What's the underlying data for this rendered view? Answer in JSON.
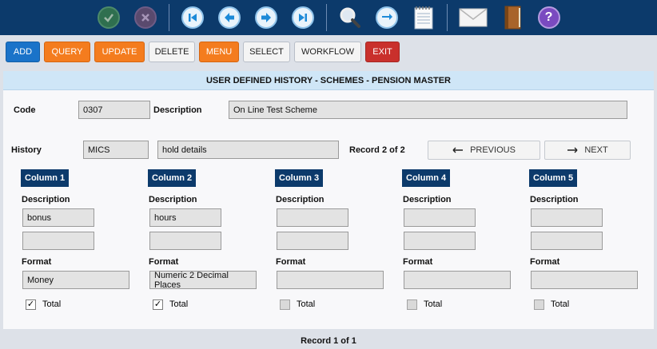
{
  "toolbar": {
    "icons": [
      "check-icon",
      "cancel-icon",
      "first-record-icon",
      "previous-record-icon",
      "next-record-icon",
      "last-record-icon",
      "search-icon",
      "refresh-icon",
      "notepad-icon",
      "mail-icon",
      "book-icon",
      "help-icon"
    ],
    "help_glyph": "?"
  },
  "actions": {
    "add": "ADD",
    "query": "QUERY",
    "update": "UPDATE",
    "delete": "DELETE",
    "menu": "MENU",
    "select": "SELECT",
    "workflow": "WORKFLOW",
    "exit": "EXIT"
  },
  "panel": {
    "title": "USER DEFINED HISTORY - SCHEMES - PENSION MASTER",
    "code_label": "Code",
    "code_value": "0307",
    "description_label": "Description",
    "description_value": "On Line Test Scheme",
    "history_label": "History",
    "history_code": "MICS",
    "history_desc": "hold details",
    "record_label": "Record 2 of 2",
    "previous": "PREVIOUS",
    "next": "NEXT"
  },
  "columns": [
    {
      "title": "Column 1",
      "desc_label": "Description",
      "desc1": "bonus",
      "desc2": "",
      "format_label": "Format",
      "format": "Money",
      "total_label": "Total",
      "total_checked": true
    },
    {
      "title": "Column 2",
      "desc_label": "Description",
      "desc1": "hours",
      "desc2": "",
      "format_label": "Format",
      "format": "Numeric 2 Decimal Places",
      "total_label": "Total",
      "total_checked": true
    },
    {
      "title": "Column 3",
      "desc_label": "Description",
      "desc1": "",
      "desc2": "",
      "format_label": "Format",
      "format": "",
      "total_label": "Total",
      "total_checked": false
    },
    {
      "title": "Column 4",
      "desc_label": "Description",
      "desc1": "",
      "desc2": "",
      "format_label": "Format",
      "format": "",
      "total_label": "Total",
      "total_checked": false
    },
    {
      "title": "Column 5",
      "desc_label": "Description",
      "desc1": "",
      "desc2": "",
      "format_label": "Format",
      "format": "",
      "total_label": "Total",
      "total_checked": false
    }
  ],
  "footer": {
    "record_label": "Record 1 of 1"
  },
  "colors": {
    "navy": "#0c3a6b",
    "orange": "#f47c1e",
    "blue": "#1a73c9",
    "red": "#c9302c",
    "title_bar": "#cfe6f7"
  }
}
